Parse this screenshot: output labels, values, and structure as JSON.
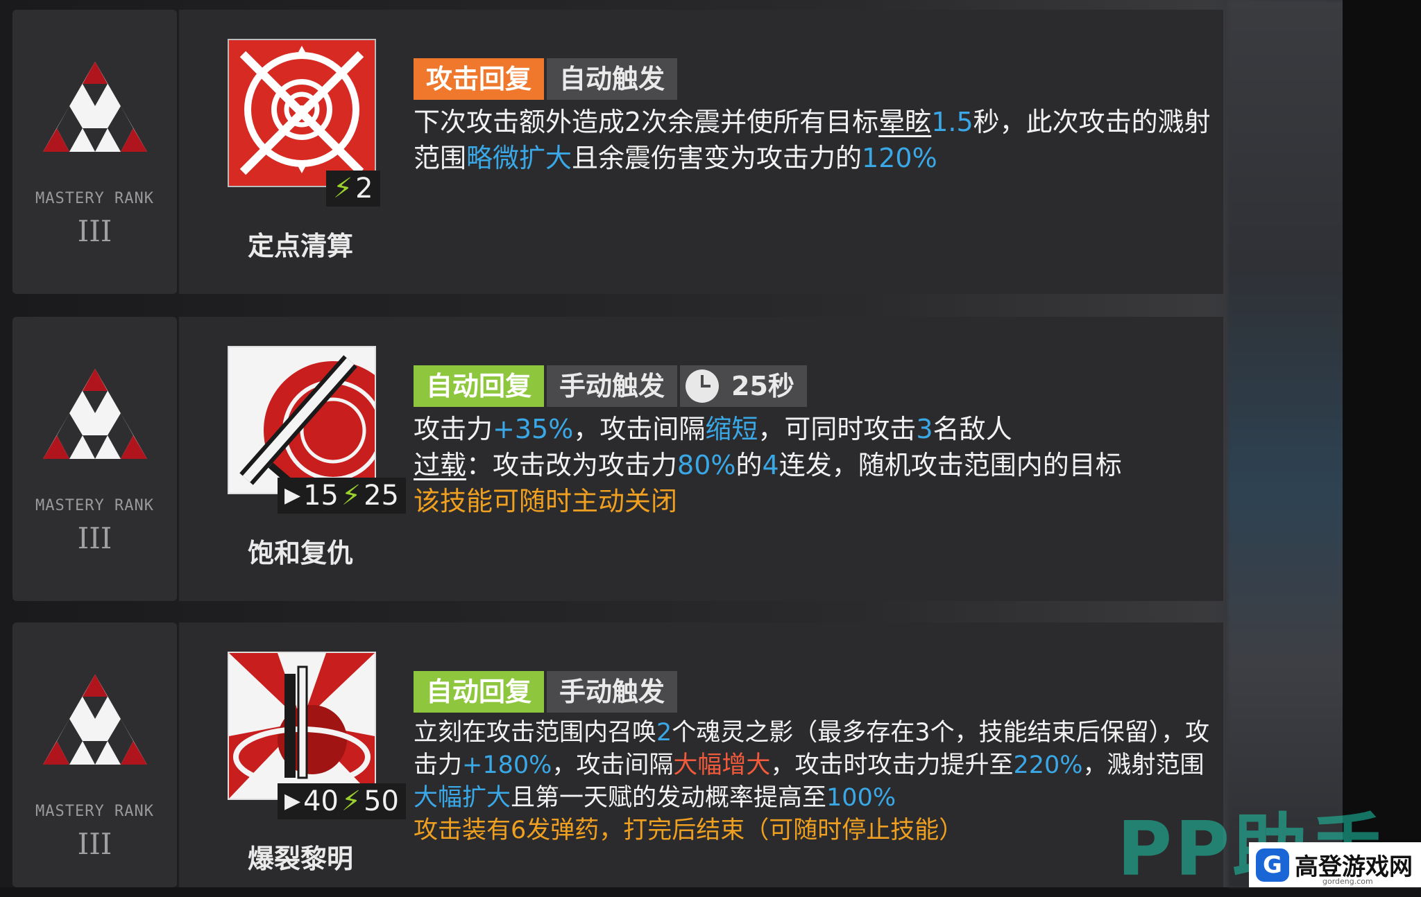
{
  "mastery": {
    "label": "MASTERY RANK",
    "roman": "III"
  },
  "skills": [
    {
      "name": "定点清算",
      "icon": "skill-icon-spiral-target",
      "stats": {
        "bolt": "2"
      },
      "tags": {
        "recovery": "攻击回复",
        "trigger": "自动触发"
      },
      "desc": {
        "p1": "下次攻击额外造成2次余震并使所有目标",
        "u1": "晕眩",
        "b1": "1.5",
        "p2": "秒，此次攻击的溅射范围",
        "b2": "略微扩大",
        "p3": "且余震伤害变为攻击力的",
        "b3": "120%"
      }
    },
    {
      "name": "饱和复仇",
      "icon": "skill-icon-rifle",
      "stats": {
        "play": "15",
        "bolt": "25"
      },
      "tags": {
        "recovery": "自动回复",
        "trigger": "手动触发",
        "duration": "25秒"
      },
      "desc": {
        "l1a": "攻击力",
        "l1b": "+35%",
        "l1c": "，攻击间隔",
        "l1d": "缩短",
        "l1e": "，可同时攻击",
        "l1f": "3",
        "l1g": "名敌人",
        "l2a": "过载",
        "l2b": "：攻击改为攻击力",
        "l2c": "80%",
        "l2d": "的",
        "l2e": "4",
        "l2f": "连发，随机攻击范围内的目标",
        "note": "该技能可随时主动关闭"
      }
    },
    {
      "name": "爆裂黎明",
      "icon": "skill-icon-burst",
      "stats": {
        "play": "40",
        "bolt": "50"
      },
      "tags": {
        "recovery": "自动回复",
        "trigger": "手动触发"
      },
      "desc": {
        "a": "立刻在攻击范围内召唤",
        "b": "2",
        "c": "个魂灵之影（最多存在3个，技能结束后保留），攻击力",
        "d": "+180%",
        "e": "，攻击间隔",
        "f": "大幅增大",
        "g": "，攻击时攻击力提升至",
        "h": "220%",
        "i": "，溅射范围",
        "j": "大幅扩大",
        "k": "且第一天赋的发动概率提高至",
        "l": "100%",
        "note": "攻击装有6发弹药，打完后结束（可随时停止技能）"
      }
    }
  ],
  "watermark": "PP助手",
  "site_logo": {
    "mark": "G",
    "text": "高登游戏网",
    "sub": "gordeng.com"
  },
  "colors": {
    "orange": "#f0782c",
    "green": "#8ec63d",
    "blue": "#3aa8e6",
    "red": "#f25a3c",
    "yellow": "#f0a020"
  }
}
